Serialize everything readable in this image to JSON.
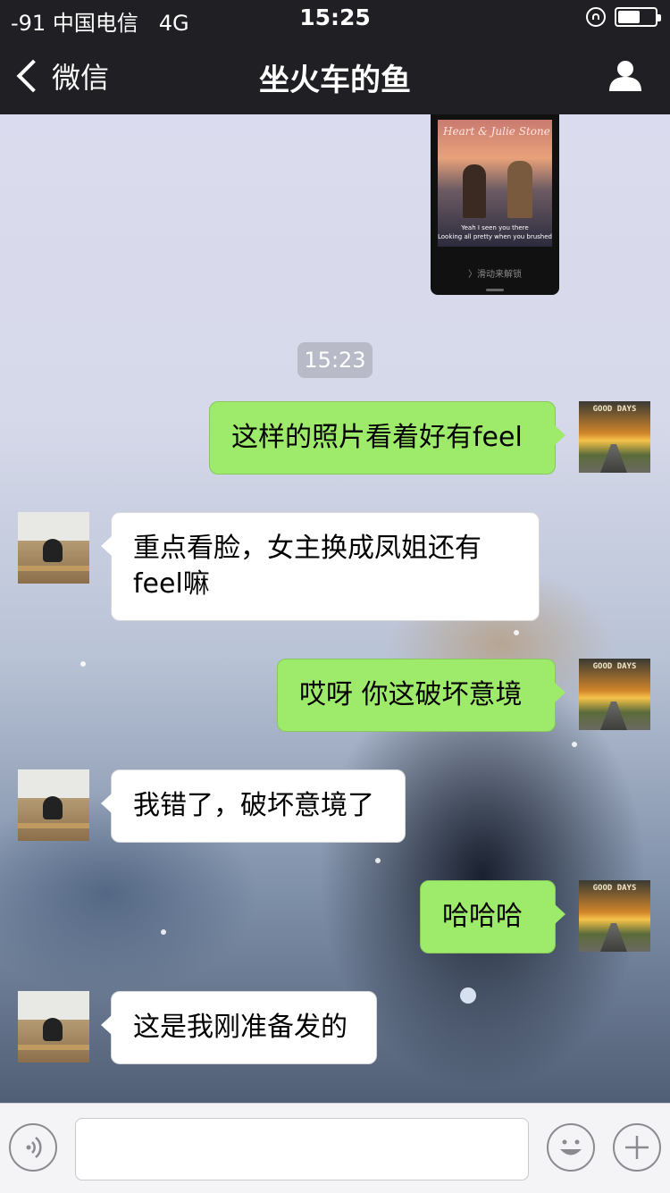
{
  "status_bar": {
    "signal": "-91",
    "carrier": "中国电信",
    "network": "4G",
    "time": "15:25"
  },
  "nav": {
    "back_label": "微信",
    "title": "坐火车的鱼"
  },
  "shared_image": {
    "script_text": "Heart & Julie Stone",
    "caption_line1": "Yeah I seen you there",
    "caption_line2": "Looking all pretty when you brushed",
    "unlock_text": "〉滑动来解锁"
  },
  "timestamp": "15:23",
  "messages": [
    {
      "sender": "me",
      "text": "这样的照片看着好有feel"
    },
    {
      "sender": "them",
      "text": "重点看脸，女主换成凤姐还有feel嘛"
    },
    {
      "sender": "me",
      "text": "哎呀 你这破坏意境"
    },
    {
      "sender": "them",
      "text": "我错了，破坏意境了"
    },
    {
      "sender": "me",
      "text": "哈哈哈"
    },
    {
      "sender": "them",
      "text": "这是我刚准备发的"
    }
  ],
  "my_avatar_banner": "GOOD DAYS",
  "input": {
    "value": "",
    "placeholder": ""
  },
  "colors": {
    "bar_dark": "#1f1f24",
    "bubble_out": "#9eea6a",
    "bubble_in": "#ffffff"
  }
}
